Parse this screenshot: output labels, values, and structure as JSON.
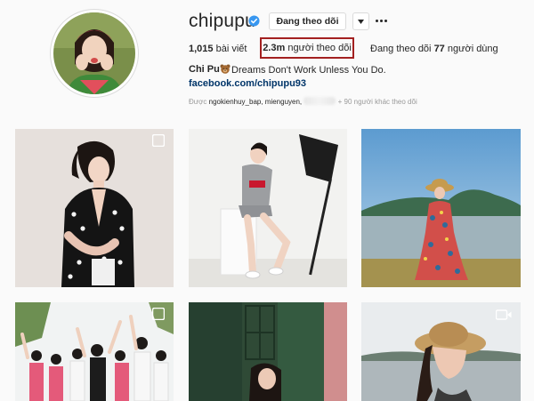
{
  "profile": {
    "username": "chipupu",
    "follow_button_label": "Đang theo dõi",
    "stats": {
      "posts_count": "1,015",
      "posts_label": "bài viết",
      "followers_count": "2.3m",
      "followers_label": "người theo dõi",
      "following_prefix": "Đang theo dõi",
      "following_count": "77",
      "following_label": "người dùng"
    },
    "full_name": "Chi Pu",
    "bio": "Dreams Don't Work Unless You Do.",
    "website": "facebook.com/chipupu93",
    "followed_by": {
      "prefix": "Được",
      "names": "ngokienhuy_bap, mienguyen,",
      "suffix": "+ 90 người khác theo dõi"
    }
  },
  "icons": {
    "verified": "verified-badge-icon",
    "dropdown": "chevron-down-icon",
    "more": "more-options-icon",
    "bio_emoji": "bear-face-icon",
    "multi_photo": "carousel-icon",
    "video": "video-icon"
  },
  "colors": {
    "background": "#fafafa",
    "verified_blue": "#3897f0",
    "link": "#003569",
    "highlight_box": "#a32020"
  }
}
